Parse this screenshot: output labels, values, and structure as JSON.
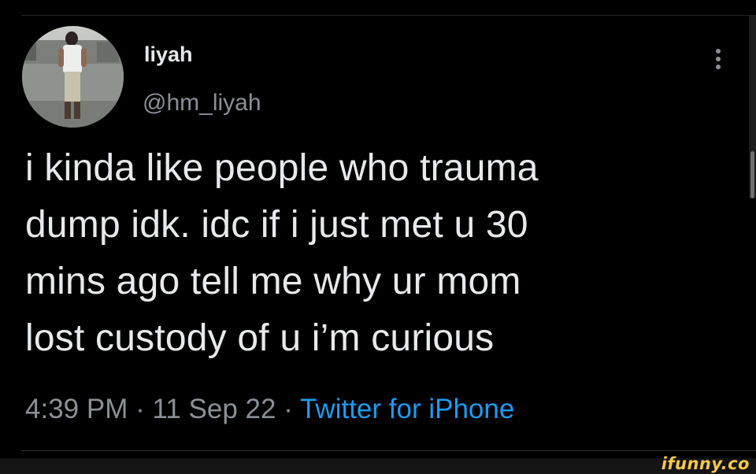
{
  "tweet": {
    "author": {
      "display_name": "liyah",
      "handle": "@hm_liyah"
    },
    "text_lines": [
      "i kinda like people who trauma",
      "dump idk. idc if i just met u 30",
      "mins ago tell me why ur mom",
      "lost custody of u i’m curious"
    ],
    "time": "4:39 PM",
    "separator": "·",
    "date": "11 Sep 22",
    "source": "Twitter for iPhone"
  },
  "icons": {
    "more": "more-vertical-icon",
    "avatar": "profile-photo"
  },
  "watermark": {
    "text": "ifunny.co"
  },
  "colors": {
    "background": "#000000",
    "primary_text": "#e7e9ea",
    "secondary_text": "#8b9096",
    "link": "#1d9bf0",
    "watermark": "#f6c945"
  }
}
